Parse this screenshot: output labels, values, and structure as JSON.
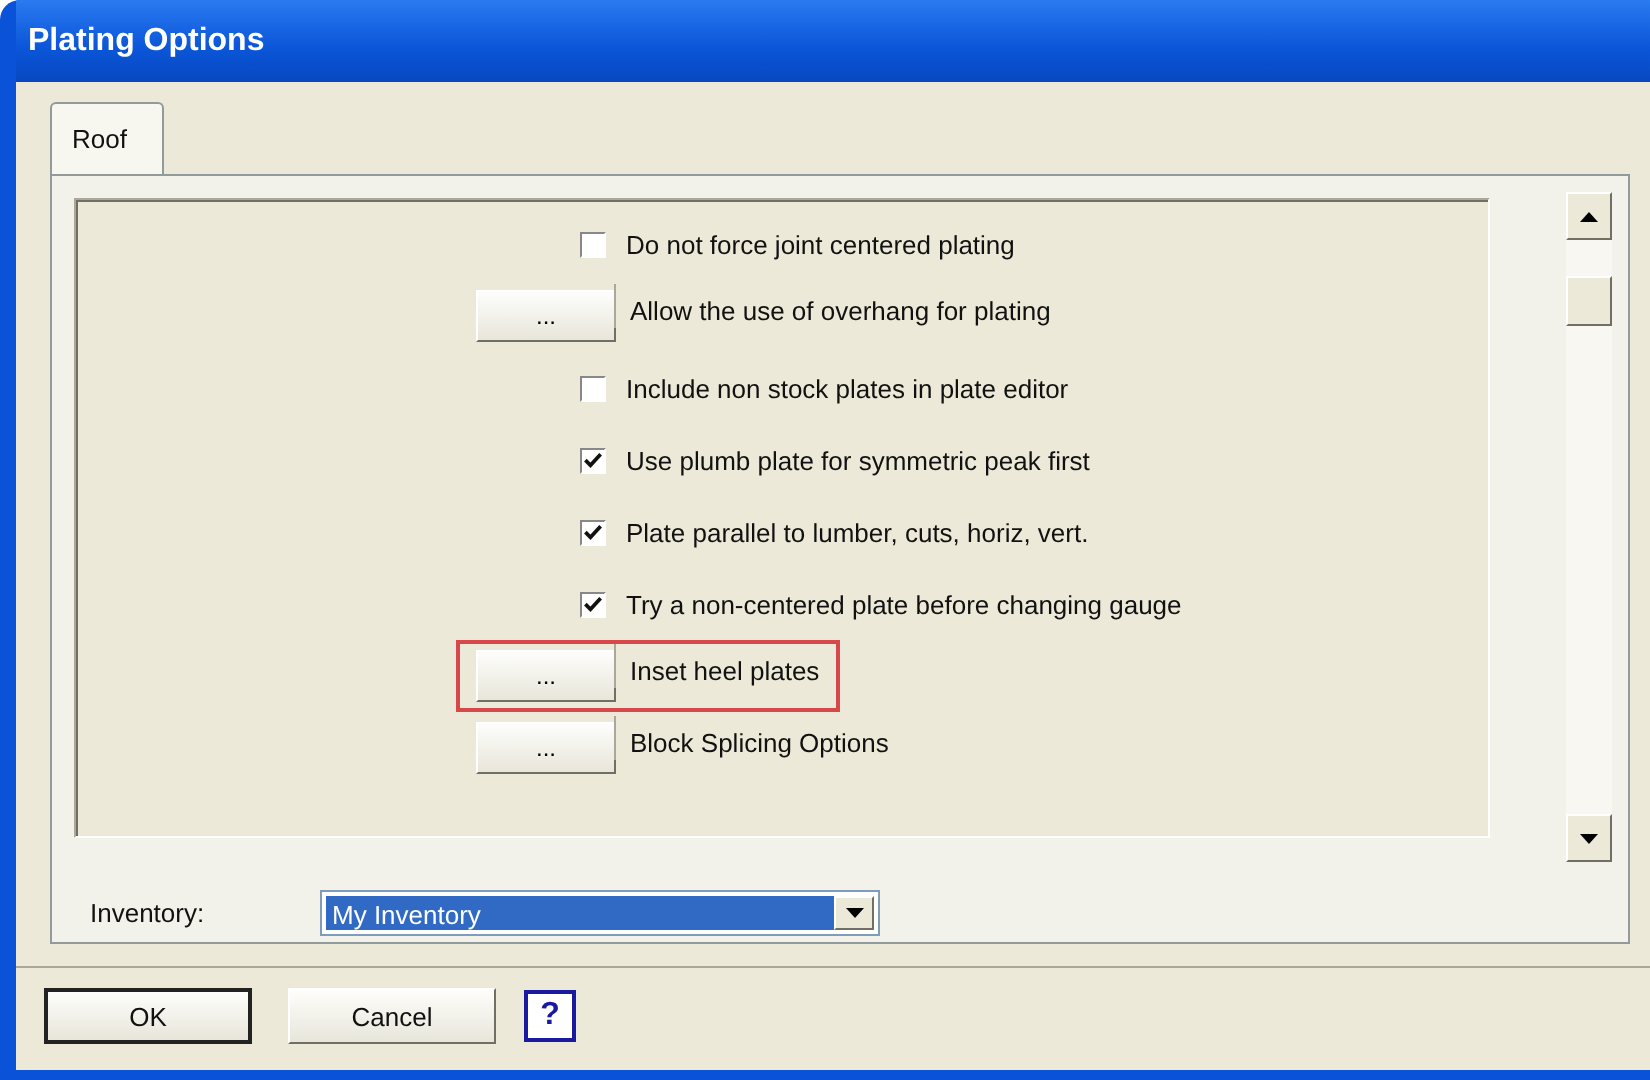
{
  "window": {
    "title": "Plating Options"
  },
  "tabs": [
    {
      "label": "Roof",
      "selected": true
    }
  ],
  "options": [
    {
      "kind": "checkbox",
      "label": "Do not force joint centered plating",
      "checked": false,
      "highlighted": false
    },
    {
      "kind": "button",
      "button": "...",
      "label": "Allow the use of overhang for plating",
      "highlighted": false
    },
    {
      "kind": "checkbox",
      "label": "Include non stock plates in plate editor",
      "checked": false,
      "highlighted": false
    },
    {
      "kind": "checkbox",
      "label": "Use plumb plate for symmetric peak first",
      "checked": true,
      "highlighted": false
    },
    {
      "kind": "checkbox",
      "label": "Plate parallel to lumber, cuts, horiz, vert.",
      "checked": true,
      "highlighted": false
    },
    {
      "kind": "checkbox",
      "label": "Try a non-centered plate before changing gauge",
      "checked": true,
      "highlighted": false
    },
    {
      "kind": "button",
      "button": "...",
      "label": "Inset heel plates",
      "highlighted": true
    },
    {
      "kind": "button",
      "button": "...",
      "label": "Block Splicing Options",
      "highlighted": false
    }
  ],
  "inventory": {
    "label": "Inventory:",
    "value": "My Inventory"
  },
  "buttons": [
    {
      "label": "OK",
      "default": true
    },
    {
      "label": "Cancel",
      "default": false
    }
  ],
  "help": "?"
}
